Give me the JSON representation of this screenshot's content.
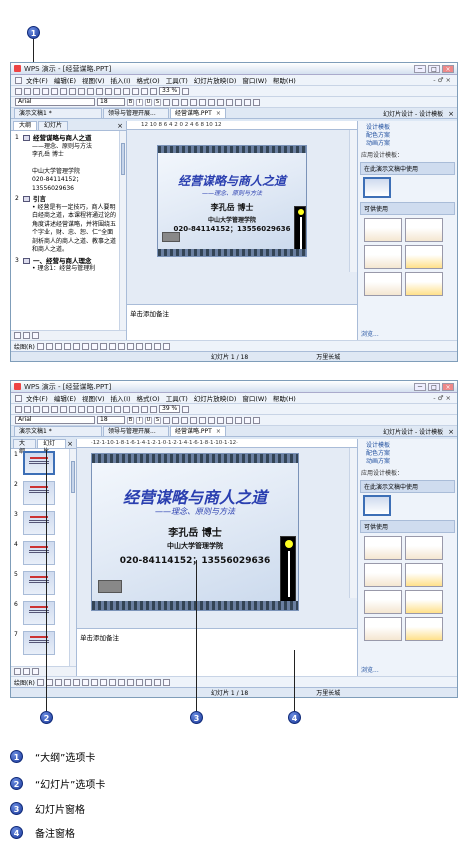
{
  "window": {
    "title": "WPS 演示 - [经营谋略.PPT]",
    "controls": [
      "－",
      "□",
      "×"
    ]
  },
  "menu": {
    "items": [
      "文件(F)",
      "编辑(E)",
      "视图(V)",
      "插入(I)",
      "格式(O)",
      "工具(T)",
      "幻灯片放映(D)",
      "窗口(W)",
      "帮助(H)"
    ],
    "right": "- ♂ ×"
  },
  "toolbar": {
    "zoom": "33 %",
    "zoom2": "39 %",
    "font": "Arial",
    "size": "18"
  },
  "doc_tabs": [
    {
      "label": "演示文稿1 *",
      "active": false
    },
    {
      "label": "领导与管理开展...",
      "active": false
    },
    {
      "label": "经营谋略.PPT",
      "active": true
    }
  ],
  "left_tabs": {
    "outline": "大纲",
    "slides": "幻灯片",
    "close": "×"
  },
  "outline": {
    "s1": {
      "num": "1",
      "title": "经营谋略与商人之道",
      "lines": [
        "——理念、原则与方法",
        "李孔岳 博士",
        "",
        "中山大学管理学院",
        "020-84114152；",
        "13556029636"
      ]
    },
    "s2": {
      "num": "2",
      "title": "引言",
      "lines": [
        "• 经营是有一定技巧，商人要明白经商之道，本课程将通过论的角度讲述经营谋略，并将围绕五个字业，财、忠、恕、仁“全面剖析商人的商人之道、教事之道和商人之道。"
      ]
    },
    "s3": {
      "num": "3",
      "title": "一、经营与商人理念",
      "lines": [
        "• 理念1：经营与管理利"
      ]
    }
  },
  "thumbs": [
    "1",
    "2",
    "3",
    "4",
    "5",
    "6",
    "7"
  ],
  "ruler": {
    "top": "12 10 8 6 4 2 0 2 4 6 8 10 12",
    "top2": "·12·1·10·1·8·1·6·1·4·1·2·1·0·1·2·1·4·1·6·1·8·1·10·1·12·"
  },
  "slide": {
    "title": "经营谋略与商人之道",
    "subtitle": "——理念、原则与方法",
    "author": "李孔岳 博士",
    "org": "中山大学管理学院",
    "phone": "020-84114152；13556029636"
  },
  "notes": {
    "placeholder": "单击添加备注"
  },
  "taskpane": {
    "title": "幻灯片设计 - 设计模板",
    "close": "×",
    "links": [
      "设计模板",
      "配色方案",
      "动画方案"
    ],
    "apply_label": "应用设计模板：",
    "in_use": "在此演示文稿中使用",
    "available": "可供使用",
    "browse": "浏览..."
  },
  "status": {
    "page": "幻灯片 1 / 18",
    "theme": "万里长城"
  },
  "drawbar": {
    "label": "绘图(R)"
  },
  "callouts": [
    "1",
    "2",
    "3",
    "4"
  ],
  "legend": [
    {
      "num": "1",
      "text": "“大纲”选项卡"
    },
    {
      "num": "2",
      "text": "“幻灯片”选项卡"
    },
    {
      "num": "3",
      "text": "幻灯片窗格"
    },
    {
      "num": "4",
      "text": "备注窗格"
    }
  ]
}
